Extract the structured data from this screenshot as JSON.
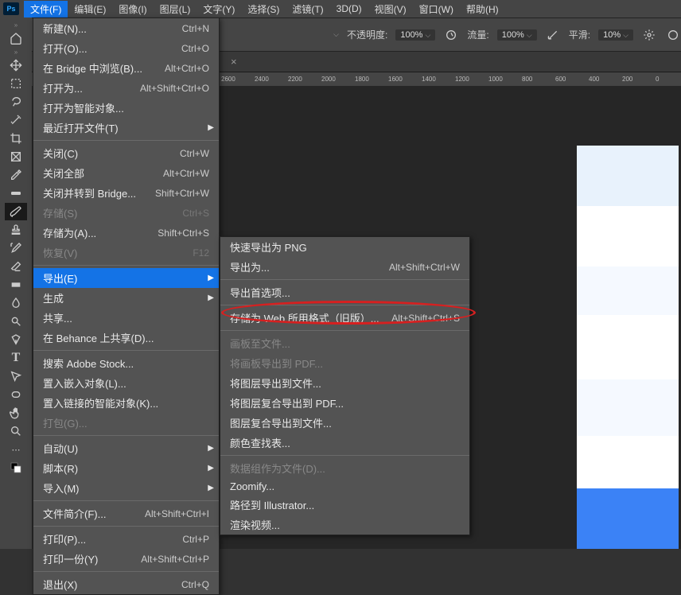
{
  "menubar": {
    "items": [
      "文件(F)",
      "编辑(E)",
      "图像(I)",
      "图层(L)",
      "文字(Y)",
      "选择(S)",
      "滤镜(T)",
      "3D(D)",
      "视图(V)",
      "窗口(W)",
      "帮助(H)"
    ]
  },
  "options": {
    "opacity_label": "不透明度:",
    "opacity_val": "100%",
    "flow_label": "流量:",
    "flow_val": "100%",
    "smooth_label": "平滑:",
    "smooth_val": "10%"
  },
  "ruler": [
    "2600",
    "2400",
    "2200",
    "2000",
    "1800",
    "1600",
    "1400",
    "1200",
    "1000",
    "800",
    "600",
    "400",
    "200",
    "0"
  ],
  "file_menu": [
    {
      "label": "新建(N)...",
      "shortcut": "Ctrl+N"
    },
    {
      "label": "打开(O)...",
      "shortcut": "Ctrl+O"
    },
    {
      "label": "在 Bridge 中浏览(B)...",
      "shortcut": "Alt+Ctrl+O"
    },
    {
      "label": "打开为...",
      "shortcut": "Alt+Shift+Ctrl+O"
    },
    {
      "label": "打开为智能对象..."
    },
    {
      "label": "最近打开文件(T)",
      "arrow": true
    },
    {
      "sep": true
    },
    {
      "label": "关闭(C)",
      "shortcut": "Ctrl+W"
    },
    {
      "label": "关闭全部",
      "shortcut": "Alt+Ctrl+W"
    },
    {
      "label": "关闭并转到 Bridge...",
      "shortcut": "Shift+Ctrl+W"
    },
    {
      "label": "存储(S)",
      "shortcut": "Ctrl+S",
      "disabled": true
    },
    {
      "label": "存储为(A)...",
      "shortcut": "Shift+Ctrl+S"
    },
    {
      "label": "恢复(V)",
      "shortcut": "F12",
      "disabled": true
    },
    {
      "sep": true
    },
    {
      "label": "导出(E)",
      "arrow": true,
      "hover": true
    },
    {
      "label": "生成",
      "arrow": true
    },
    {
      "label": "共享..."
    },
    {
      "label": "在 Behance 上共享(D)..."
    },
    {
      "sep": true
    },
    {
      "label": "搜索 Adobe Stock..."
    },
    {
      "label": "置入嵌入对象(L)..."
    },
    {
      "label": "置入链接的智能对象(K)..."
    },
    {
      "label": "打包(G)...",
      "disabled": true
    },
    {
      "sep": true
    },
    {
      "label": "自动(U)",
      "arrow": true
    },
    {
      "label": "脚本(R)",
      "arrow": true
    },
    {
      "label": "导入(M)",
      "arrow": true
    },
    {
      "sep": true
    },
    {
      "label": "文件简介(F)...",
      "shortcut": "Alt+Shift+Ctrl+I"
    },
    {
      "sep": true
    },
    {
      "label": "打印(P)...",
      "shortcut": "Ctrl+P"
    },
    {
      "label": "打印一份(Y)",
      "shortcut": "Alt+Shift+Ctrl+P"
    },
    {
      "sep": true
    },
    {
      "label": "退出(X)",
      "shortcut": "Ctrl+Q"
    }
  ],
  "export_menu": [
    {
      "label": "快速导出为 PNG"
    },
    {
      "label": "导出为...",
      "shortcut": "Alt+Shift+Ctrl+W"
    },
    {
      "sep": true
    },
    {
      "label": "导出首选项..."
    },
    {
      "sep": true
    },
    {
      "label": "存储为 Web 所用格式（旧版）...",
      "shortcut": "Alt+Shift+Ctrl+S"
    },
    {
      "sep": true
    },
    {
      "label": "画板至文件...",
      "disabled": true
    },
    {
      "label": "将画板导出到 PDF...",
      "disabled": true
    },
    {
      "label": "将图层导出到文件..."
    },
    {
      "label": "将图层复合导出到 PDF..."
    },
    {
      "label": "图层复合导出到文件..."
    },
    {
      "label": "颜色查找表..."
    },
    {
      "sep": true
    },
    {
      "label": "数据组作为文件(D)...",
      "disabled": true
    },
    {
      "label": "Zoomify..."
    },
    {
      "label": "路径到 Illustrator..."
    },
    {
      "label": "渲染视频..."
    }
  ]
}
